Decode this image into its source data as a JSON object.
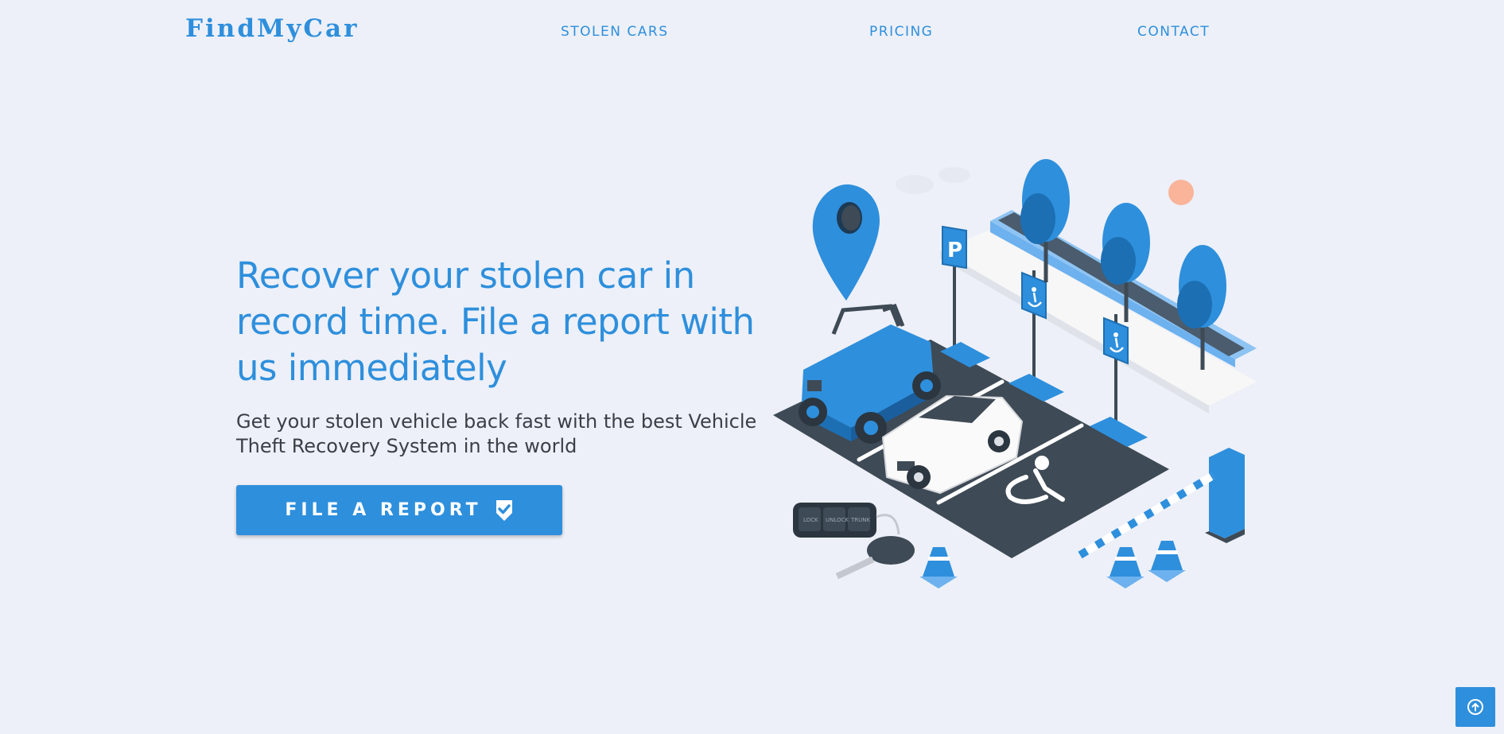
{
  "brand": {
    "name": "FindMyCar"
  },
  "nav": {
    "items": [
      {
        "label": "STOLEN CARS"
      },
      {
        "label": "PRICING"
      },
      {
        "label": "CONTACT"
      }
    ]
  },
  "hero": {
    "title": "Recover your stolen car in record time. File a report with us immediately",
    "subtitle": "Get your stolen vehicle back fast with the best Vehicle Theft Recovery System in the world",
    "cta_label": "FILE A REPORT",
    "cta_icon": "shield-check-icon"
  },
  "illustration": {
    "signs": {
      "parking": "P"
    },
    "key_fob": [
      "LOCK",
      "UNLOCK",
      "TRUNK"
    ]
  },
  "scroll_top": {
    "icon": "arrow-up-circle-icon"
  },
  "colors": {
    "background": "#edf0f8",
    "accent": "#2e8fdc",
    "heading": "#2e8fdc",
    "body_text": "#3a3f47",
    "asphalt": "#3e4a55",
    "sun": "#f9b49a"
  }
}
